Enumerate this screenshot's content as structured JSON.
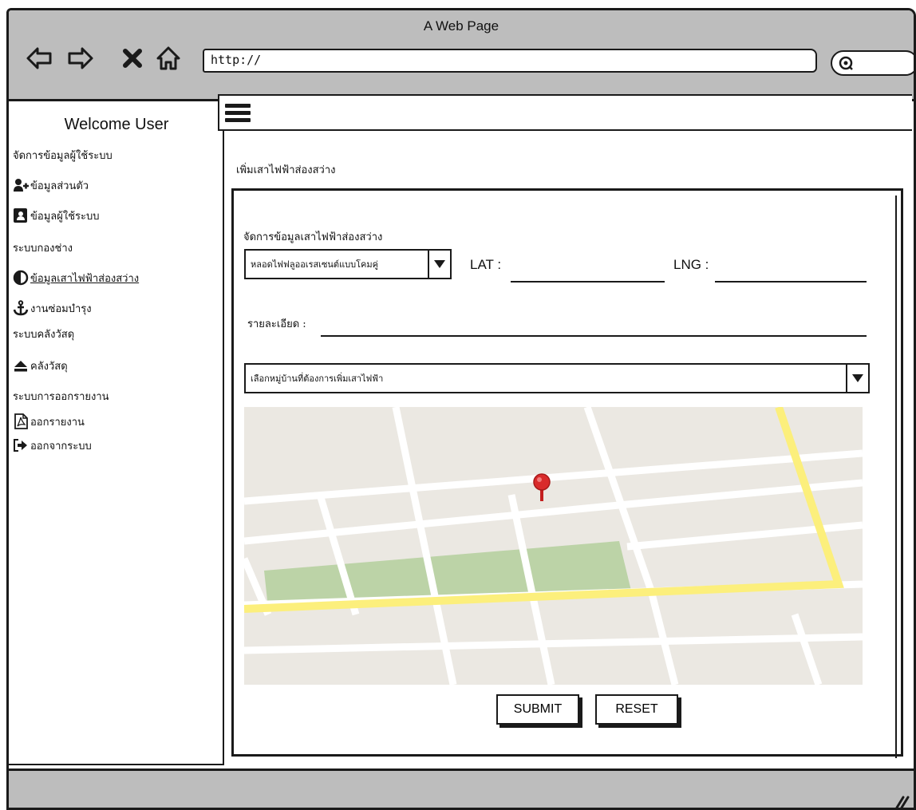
{
  "window": {
    "title": "A Web Page"
  },
  "toolbar": {
    "back_icon": "back-arrow-icon",
    "forward_icon": "forward-arrow-icon",
    "stop_icon": "close-icon",
    "home_icon": "home-icon",
    "url": "http://",
    "search_icon": "search-icon"
  },
  "sidebar": {
    "title": "Welcome User",
    "items": [
      {
        "label": "จัดการข้อมูลผู้ใช้ระบบ",
        "type": "section",
        "icon": null
      },
      {
        "label": "ข้อมูลส่วนตัว",
        "type": "link",
        "icon": "user-plus-icon"
      },
      {
        "label": "ข้อมูลผู้ใช้ระบบ",
        "type": "link",
        "icon": "address-book-icon"
      },
      {
        "label": "ระบบกองช่าง",
        "type": "section",
        "icon": null
      },
      {
        "label": "ข้อมูลเสาไฟฟ้าส่องสว่าง",
        "type": "link",
        "icon": "half-circle-icon",
        "active": true
      },
      {
        "label": "งานซ่อมบำรุง",
        "type": "link",
        "icon": "anchor-icon"
      },
      {
        "label": "ระบบคลังวัสดุ",
        "type": "section",
        "icon": null
      },
      {
        "label": "คลังวัสดุ",
        "type": "link",
        "icon": "eject-icon"
      },
      {
        "label": "ระบบการออกรายงาน",
        "type": "section",
        "icon": null
      },
      {
        "label": "ออกรายงาน",
        "type": "link",
        "icon": "pdf-file-icon"
      },
      {
        "label": "ออกจากระบบ",
        "type": "link",
        "icon": "sign-out-icon"
      }
    ]
  },
  "content": {
    "heading": "เพิ่มเสาไฟฟ้าส่องสว่าง",
    "form": {
      "title": "จัดการข้อมูลเสาไฟฟ้าส่องสว่าง",
      "lamp_type_selected": "หลอดไฟฟลูออเรสเซนต์แบบโคมคู่",
      "lat_label": "LAT :",
      "lat_value": "",
      "lng_label": "LNG :",
      "lng_value": "",
      "detail_label": "รายละเอียด :",
      "detail_value": "",
      "village_selected": "เลือกหมู่บ้านที่ต้องการเพิ่มเสาไฟฟ้า",
      "submit_label": "SUBMIT",
      "reset_label": "RESET"
    },
    "map": {
      "marker_icon": "map-pin-icon",
      "road_color": "#ffffff",
      "highway_color": "#fcef7c",
      "park_color": "#bcd3a7",
      "land_color": "#ebe8e2",
      "marker_color": "#d92b2b"
    }
  },
  "colors": {
    "chrome": "#bdbdbd",
    "ink": "#1a1a1a"
  }
}
